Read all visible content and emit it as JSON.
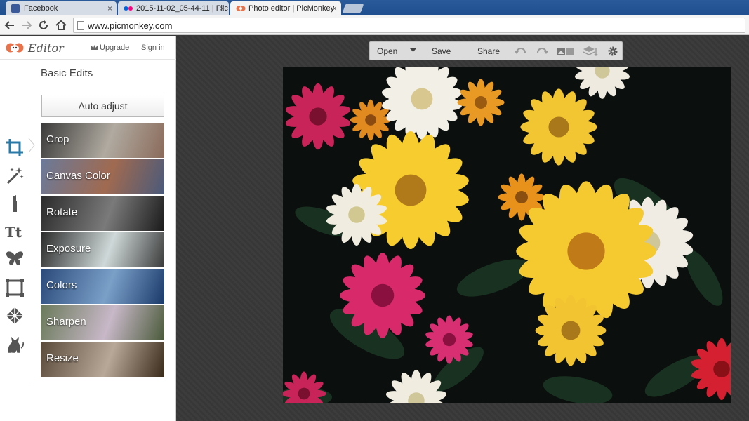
{
  "browser": {
    "tabs": [
      {
        "title": "Facebook",
        "favicon": "facebook-icon",
        "active": false
      },
      {
        "title": "2015-11-02_05-44-11 | Flic",
        "favicon": "flickr-icon",
        "active": false
      },
      {
        "title": "Photo editor | PicMonkey",
        "favicon": "picmonkey-icon",
        "active": true
      }
    ],
    "close_glyph": "×",
    "url": "www.picmonkey.com"
  },
  "editor": {
    "logo_text": "Editor",
    "upgrade_label": "Upgrade",
    "signin_label": "Sign in",
    "section_title": "Basic Edits",
    "auto_adjust_label": "Auto adjust",
    "tools": [
      "crop-tool-icon",
      "magic-wand-icon",
      "lipstick-icon",
      "text-icon",
      "butterfly-icon",
      "frame-icon",
      "texture-icon",
      "cat-icon"
    ],
    "edits": [
      {
        "label": "Crop",
        "colors": [
          "#3a3a3a",
          "#b0aaa0",
          "#8a6a5a"
        ]
      },
      {
        "label": "Canvas Color",
        "colors": [
          "#6a7a9a",
          "#a06a50",
          "#4a5a7a"
        ]
      },
      {
        "label": "Rotate",
        "colors": [
          "#2a2a2a",
          "#7a7a7a",
          "#1a1a1a"
        ]
      },
      {
        "label": "Exposure",
        "colors": [
          "#2a2a2a",
          "#cfd8d8",
          "#3a3a3a"
        ]
      },
      {
        "label": "Colors",
        "colors": [
          "#2a4a7a",
          "#7aa0c8",
          "#1a3a6a"
        ]
      },
      {
        "label": "Sharpen",
        "colors": [
          "#6a7a5a",
          "#c8b8c8",
          "#4a5a3a"
        ]
      },
      {
        "label": "Resize",
        "colors": [
          "#5a4a3a",
          "#b8a898",
          "#3a2a1a"
        ]
      }
    ]
  },
  "topbar": {
    "open_label": "Open",
    "save_label": "Save",
    "share_label": "Share"
  },
  "colors": {
    "accent": "#e8734a",
    "panel_bg": "#ffffff",
    "workspace_bg": "#3a3a3a"
  }
}
